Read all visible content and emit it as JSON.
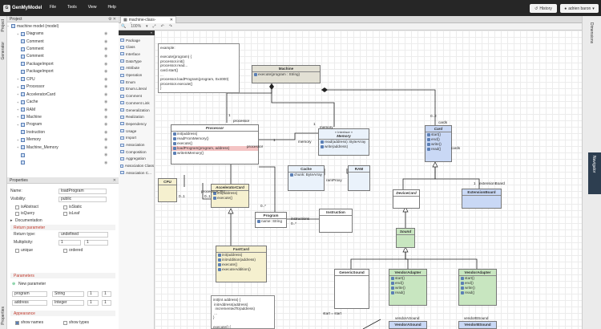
{
  "app": {
    "logo": "GenMyModel",
    "menu": [
      "File",
      "Tools",
      "View",
      "Help"
    ],
    "history_label": "History",
    "user_label": "adrien baron"
  },
  "left_tabs": [
    "Project",
    "Generator",
    "Properties"
  ],
  "project": {
    "title": "Project",
    "root": "machine model (model)",
    "items": [
      {
        "label": "Diagrams",
        "toggle": "+",
        "ind": 2
      },
      {
        "label": "Comment",
        "toggle": "",
        "ind": 2
      },
      {
        "label": "Comment",
        "toggle": "",
        "ind": 2
      },
      {
        "label": "Comment",
        "toggle": "",
        "ind": 2
      },
      {
        "label": "PackageImport",
        "toggle": "",
        "ind": 2
      },
      {
        "label": "PackageImport",
        "toggle": "",
        "ind": 2
      },
      {
        "label": "CPU",
        "toggle": "+",
        "ind": 2
      },
      {
        "label": "Processor",
        "toggle": "+",
        "ind": 2
      },
      {
        "label": "AcceleratorCard",
        "toggle": "+",
        "ind": 2
      },
      {
        "label": "Cache",
        "toggle": "+",
        "ind": 2
      },
      {
        "label": "RAM",
        "toggle": "+",
        "ind": 2
      },
      {
        "label": "Machine",
        "toggle": "+",
        "ind": 2
      },
      {
        "label": "Program",
        "toggle": "+",
        "ind": 2
      },
      {
        "label": "Instruction",
        "toggle": "",
        "ind": 2
      },
      {
        "label": "Memory",
        "toggle": "+",
        "ind": 2
      },
      {
        "label": "Machine_Memory",
        "toggle": "+",
        "ind": 2
      },
      {
        "label": "",
        "toggle": "",
        "ind": 2
      },
      {
        "label": "",
        "toggle": "",
        "ind": 2
      }
    ]
  },
  "properties": {
    "title": "Properties",
    "name_label": "Name:",
    "name_value": "loadProgram",
    "visibility_label": "Visibility:",
    "visibility_value": "public",
    "isAbstract": "isAbstract",
    "isStatic": "isStatic",
    "isQuery": "isQuery",
    "isLeaf": "isLeaf",
    "documentation": "Documentation",
    "return_title": "Return parameter",
    "return_type_label": "Return type:",
    "return_type_value": "undefined",
    "multiplicity_label": "Multiplicity:",
    "mult_lower": "1",
    "mult_upper": "1",
    "unique": "unique",
    "ordered": "ordered",
    "parameters_title": "Parameters",
    "new_parameter": "New parameter",
    "params": [
      {
        "name": "program",
        "type": "String",
        "lower": "1",
        "upper": "1"
      },
      {
        "name": "address",
        "type": "Integer",
        "lower": "1",
        "upper": "1"
      }
    ],
    "appearance_title": "Appearance",
    "show_names": "show names",
    "show_types": "show types"
  },
  "editor": {
    "tab_label": "machine-class-diagram",
    "zoom": "100%"
  },
  "palette": {
    "items": [
      "Package",
      "Class",
      "Interface",
      "DataType",
      "Attribute",
      "Operation",
      "Enum",
      "Enum.Literal",
      "Comment",
      "Comment Link",
      "Generalization",
      "Realization",
      "Dependency",
      "Usage",
      "Import",
      "Association",
      "Composition",
      "Aggregation",
      "Association Class",
      "Association C..."
    ]
  },
  "right_tabs": {
    "top": "Dimensions",
    "nav": "Navigator"
  },
  "diagram": {
    "note_top": "example:\n\nexecute(program) {\nprocessor.init()\nprocessor.read...\ncard.start()\n...\nprocessor.loadProgram(program, 0x4000)\nprocessor.execute()\n}",
    "note_bottom": "init(int address) {\n initAddress(address)\n  incrementedTo(address)\n ...\n}\n\nexecute() {\n mInit(address)\n}",
    "machine": {
      "name": "Machine",
      "ops": [
        "execute(program : String)"
      ]
    },
    "processor": {
      "name": "Processor",
      "ops": [
        "init(address)",
        "readFromMemory()",
        "execute()",
        "loadProgram(program, address)",
        "writeInMemory()"
      ]
    },
    "memory": {
      "stereo": "« Interface »",
      "name": "Memory",
      "ops": [
        "read(address): ByteArray",
        "write(address)"
      ]
    },
    "card": {
      "name": "Card",
      "ops": [
        "start()",
        "end()",
        "write()",
        "read()"
      ]
    },
    "cpu": {
      "name": "CPU"
    },
    "cache": {
      "name": "Cache",
      "attrs": [
        "chunk: ByteArray"
      ]
    },
    "ram": {
      "name": "RAM"
    },
    "accel": {
      "name": "AcceleratorCard",
      "ops": [
        "init(address)",
        "execute()"
      ]
    },
    "program": {
      "name": "Program",
      "attrs": [
        "name: String"
      ]
    },
    "instruction": {
      "name": "Instruction"
    },
    "devicecard": {
      "name": "DeviceCard"
    },
    "extension": {
      "name": "ExtensionBoard"
    },
    "sound": {
      "name": "Sound"
    },
    "fastcard": {
      "name": "FastCard",
      "ops": [
        "init(address)",
        "initAddition(address)",
        "execute()",
        "executeAddition()"
      ]
    },
    "generic": {
      "name": "GenericSound"
    },
    "vendorA": {
      "name": "VendorAdapter",
      "ops": [
        "start()",
        "end()",
        "write()",
        "read()"
      ],
      "foot": "VendorASound"
    },
    "vendorB": {
      "name": "VendorAdapter",
      "ops": [
        "start()",
        "end()",
        "write()",
        "read()"
      ],
      "foot": "VendorBSound"
    },
    "labels": {
      "processor": "processor",
      "memory": "memory",
      "mult1": "1",
      "mult2": "1",
      "mult3": "0..1",
      "mult4": "1",
      "mult5": "1",
      "mult6": "0..*",
      "card_role": "cards",
      "card_mult": "0..2",
      "extension_role": "extensionBoard",
      "ramproxy": "ramProxy",
      "instructions": "instructions",
      "programs": "0..*",
      "accel_role": "processorCPU",
      "accel_mult": "0..1",
      "vendora": "vendorASound",
      "vendorb": "vendorBSound",
      "start": "start = start"
    }
  }
}
